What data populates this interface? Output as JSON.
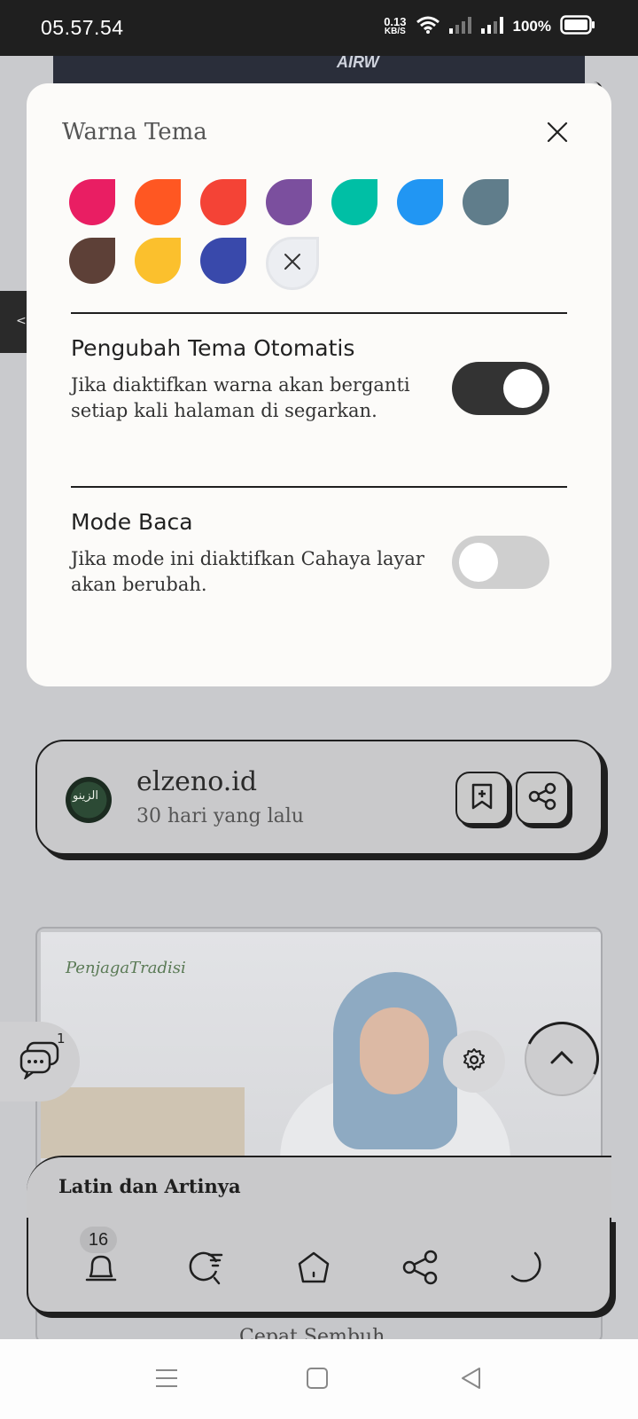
{
  "status_bar": {
    "time": "05.57.54",
    "net_speed_value": "0.13",
    "net_speed_unit": "KB/S",
    "battery": "100%"
  },
  "background": {
    "hero_text": "AIRW",
    "left_tab_glyph": "<",
    "author": {
      "name": "elzeno.id",
      "time": "30 hari yang lalu"
    },
    "article": {
      "logo": "PenjagaTradisi",
      "footer_text": "Cepat Sembuh"
    },
    "chat_badge": "1",
    "related_title": "Latin dan Artinya",
    "notif_count": "16"
  },
  "modal": {
    "title": "Warna Tema",
    "colors": [
      "#e91e63",
      "#ff5722",
      "#f44336",
      "#7b4f9e",
      "#00bfa5",
      "#2196f3",
      "#607d8b",
      "#5d4037",
      "#fbc02d",
      "#3949ab"
    ],
    "auto_theme": {
      "title": "Pengubah Tema Otomatis",
      "description": "Jika diaktifkan warna akan berganti setiap kali halaman di segarkan.",
      "enabled": true
    },
    "reading_mode": {
      "title": "Mode Baca",
      "description": "Jika mode ini diaktifkan Cahaya layar akan berubah.",
      "enabled": false
    }
  }
}
